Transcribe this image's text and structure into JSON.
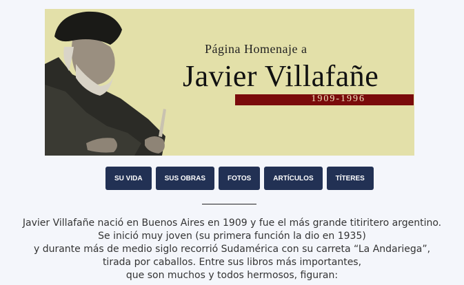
{
  "banner": {
    "pre_title": "Página Homenaje a",
    "title": "Javier Villafañe",
    "dates": "1909-1996",
    "colors": {
      "background": "#e3e0a9",
      "dates_bar": "#7a0b0b"
    }
  },
  "nav": {
    "items": [
      {
        "label": "SU VIDA"
      },
      {
        "label": "SUS OBRAS"
      },
      {
        "label": "FOTOS"
      },
      {
        "label": "ARTÍCULOS"
      },
      {
        "label": "TÍTERES"
      }
    ],
    "color": "#223154"
  },
  "intro": {
    "lines": [
      "Javier Villafañe nació en Buenos Aires en 1909 y fue el más grande titiritero argentino.",
      "Se inició muy joven (su primera función la dio en 1935)",
      "y durante más de medio siglo recorrió Sudamérica con su carreta “La Andariega”,",
      "tirada por caballos. Entre sus libros más importantes,",
      "que son muchos y todos hermosos, figuran:"
    ]
  }
}
